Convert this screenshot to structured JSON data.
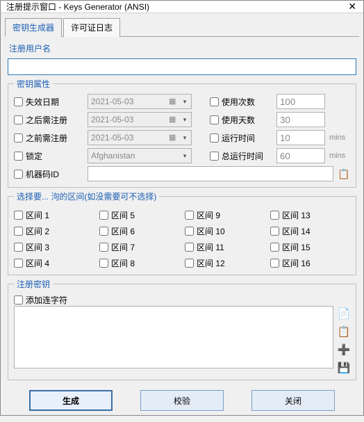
{
  "window": {
    "title": "注册提示窗口  - Keys Generator (ANSI)"
  },
  "tabs": {
    "generator": "密钥生成器",
    "log": "许可证日志"
  },
  "username": {
    "label": "注册用户名",
    "value": ""
  },
  "props": {
    "legend": "密钥属性",
    "expiry": {
      "label": "失效日期",
      "date": "2021-05-03"
    },
    "reg_after": {
      "label": "之后需注册",
      "date": "2021-05-03"
    },
    "reg_before": {
      "label": "之前需注册",
      "date": "2021-05-03"
    },
    "lock": {
      "label": "锁定",
      "country": "Afghanistan"
    },
    "hwid": {
      "label": "机器码ID",
      "value": ""
    },
    "use_count": {
      "label": "使用次数",
      "value": "100"
    },
    "use_days": {
      "label": "使用天数",
      "value": "30"
    },
    "run_time": {
      "label": "运行时间",
      "value": "10",
      "unit": "mins"
    },
    "total_time": {
      "label": "总运行时间",
      "value": "60",
      "unit": "mins"
    }
  },
  "sections": {
    "legend": "选择要... 泃的区间(如没需要可不选择)",
    "items": [
      "区间 1",
      "区间 2",
      "区间 3",
      "区间 4",
      "区间 5",
      "区间 6",
      "区间 7",
      "区间 8",
      "区间 9",
      "区间 10",
      "区间 11",
      "区间 12",
      "区间 13",
      "区间 14",
      "区间 15",
      "区间 16"
    ]
  },
  "key": {
    "legend": "注册密钥",
    "hyphen_label": "添加连字符",
    "value": ""
  },
  "icons": {
    "copy": "copy",
    "paste": "paste",
    "add": "add",
    "save": "save"
  },
  "footer": {
    "generate": "生成",
    "verify": "校验",
    "close": "关闭"
  }
}
